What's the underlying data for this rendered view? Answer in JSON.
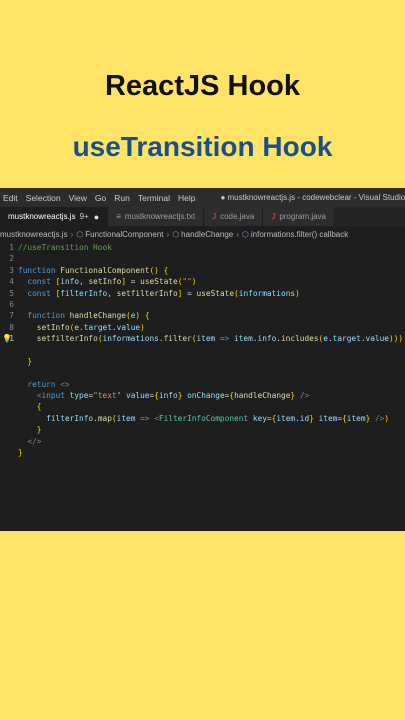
{
  "titles": {
    "main": "ReactJS Hook",
    "sub": "useTransition Hook"
  },
  "menubar": {
    "items": [
      "Edit",
      "Selection",
      "View",
      "Go",
      "Run",
      "Terminal",
      "Help"
    ],
    "window_title": "● mustknowreactjs.js - codewebclear - Visual Studio Code"
  },
  "tabs": [
    {
      "label": "mustknowreactjs.js",
      "modified": "9+",
      "icon": "js-file-icon",
      "active": true
    },
    {
      "label": "mustknowreactjs.txt",
      "icon": "text-file-icon",
      "active": false
    },
    {
      "label": "code.java",
      "icon": "java-file-icon",
      "active": false
    },
    {
      "label": "program.java",
      "icon": "java-file-icon",
      "active": false
    }
  ],
  "breadcrumbs": [
    "mustknowreactjs.js",
    "FunctionalComponent",
    "handleChange",
    "informations.filter() callback"
  ],
  "code_lines": [
    "//useTransition Hook",
    "",
    "function FunctionalComponent() {",
    "  const [info, setInfo] = useState(\"\")",
    "  const [filterInfo, setfilterInfo] = useState(informations)",
    "",
    "  function handleChange(e) {",
    "    setInfo(e.target.value)",
    "    setfilterInfo(informations.filter(item => item.info.includes(e.target.value)))",
    "",
    "  }",
    "",
    "  return <>",
    "    <input type=\"text\" value={info} onChange={handleChange} />",
    "    {",
    "      filterInfo.map(item => <FilterInfoComponent key={item.id} item={item} />)",
    "    }",
    "  </>",
    "}",
    "",
    "",
    "",
    "",
    "",
    ""
  ],
  "line_numbers": [
    "1",
    "2",
    "3",
    "4",
    "5",
    "6",
    "7",
    "8",
    "1",
    "",
    "",
    "",
    "",
    "",
    "",
    "",
    "",
    "",
    "",
    "",
    "",
    "",
    "",
    "",
    ""
  ],
  "colors": {
    "background": "#fde466",
    "title_main": "#111111",
    "title_sub": "#1b4f8a",
    "editor_bg": "#1e1e1e"
  }
}
